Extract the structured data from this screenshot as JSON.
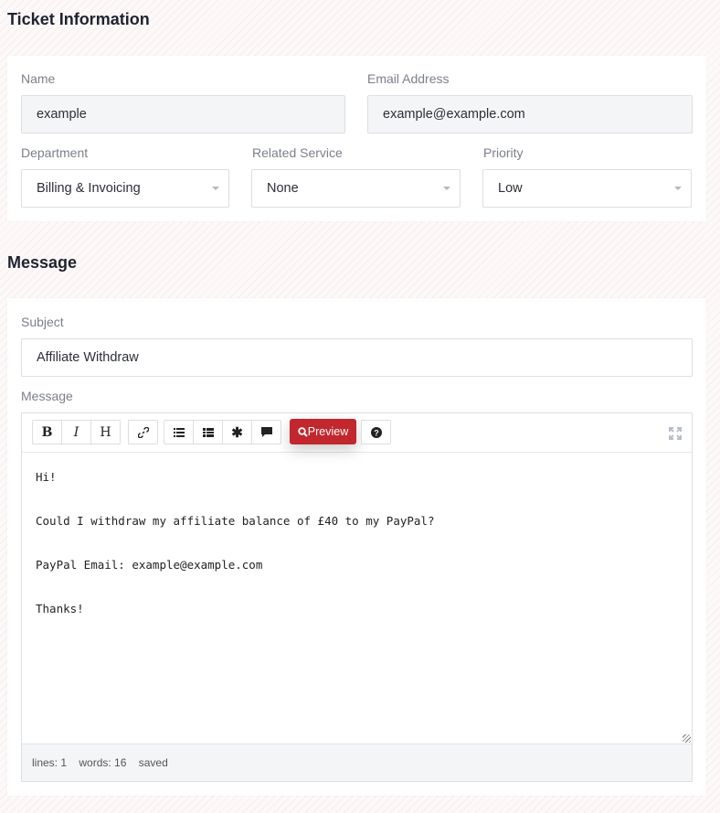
{
  "ticket_info": {
    "title": "Ticket Information",
    "name": {
      "label": "Name",
      "value": "example"
    },
    "email": {
      "label": "Email Address",
      "value": "example@example.com"
    },
    "department": {
      "label": "Department",
      "value": "Billing & Invoicing"
    },
    "related_service": {
      "label": "Related Service",
      "value": "None"
    },
    "priority": {
      "label": "Priority",
      "value": "Low"
    }
  },
  "message": {
    "title": "Message",
    "subject": {
      "label": "Subject",
      "value": "Affiliate Withdraw"
    },
    "message_label": "Message",
    "toolbar": {
      "bold": "B",
      "italic": "I",
      "heading": "H",
      "preview_label": "Preview",
      "icons": [
        "bold-icon",
        "italic-icon",
        "heading-icon",
        "link-icon",
        "unordered-list-icon",
        "ordered-list-icon",
        "asterisk-icon",
        "comment-icon",
        "search-icon",
        "question-icon",
        "fullscreen-icon"
      ]
    },
    "body_lines": [
      "Hi!",
      "",
      "Could I withdraw my affiliate balance of £40 to my PayPal?",
      "",
      "PayPal Email: example@example.com",
      "",
      "Thanks!"
    ],
    "status": {
      "lines": "lines: 1",
      "words": "words: 16",
      "saved": "saved"
    }
  }
}
